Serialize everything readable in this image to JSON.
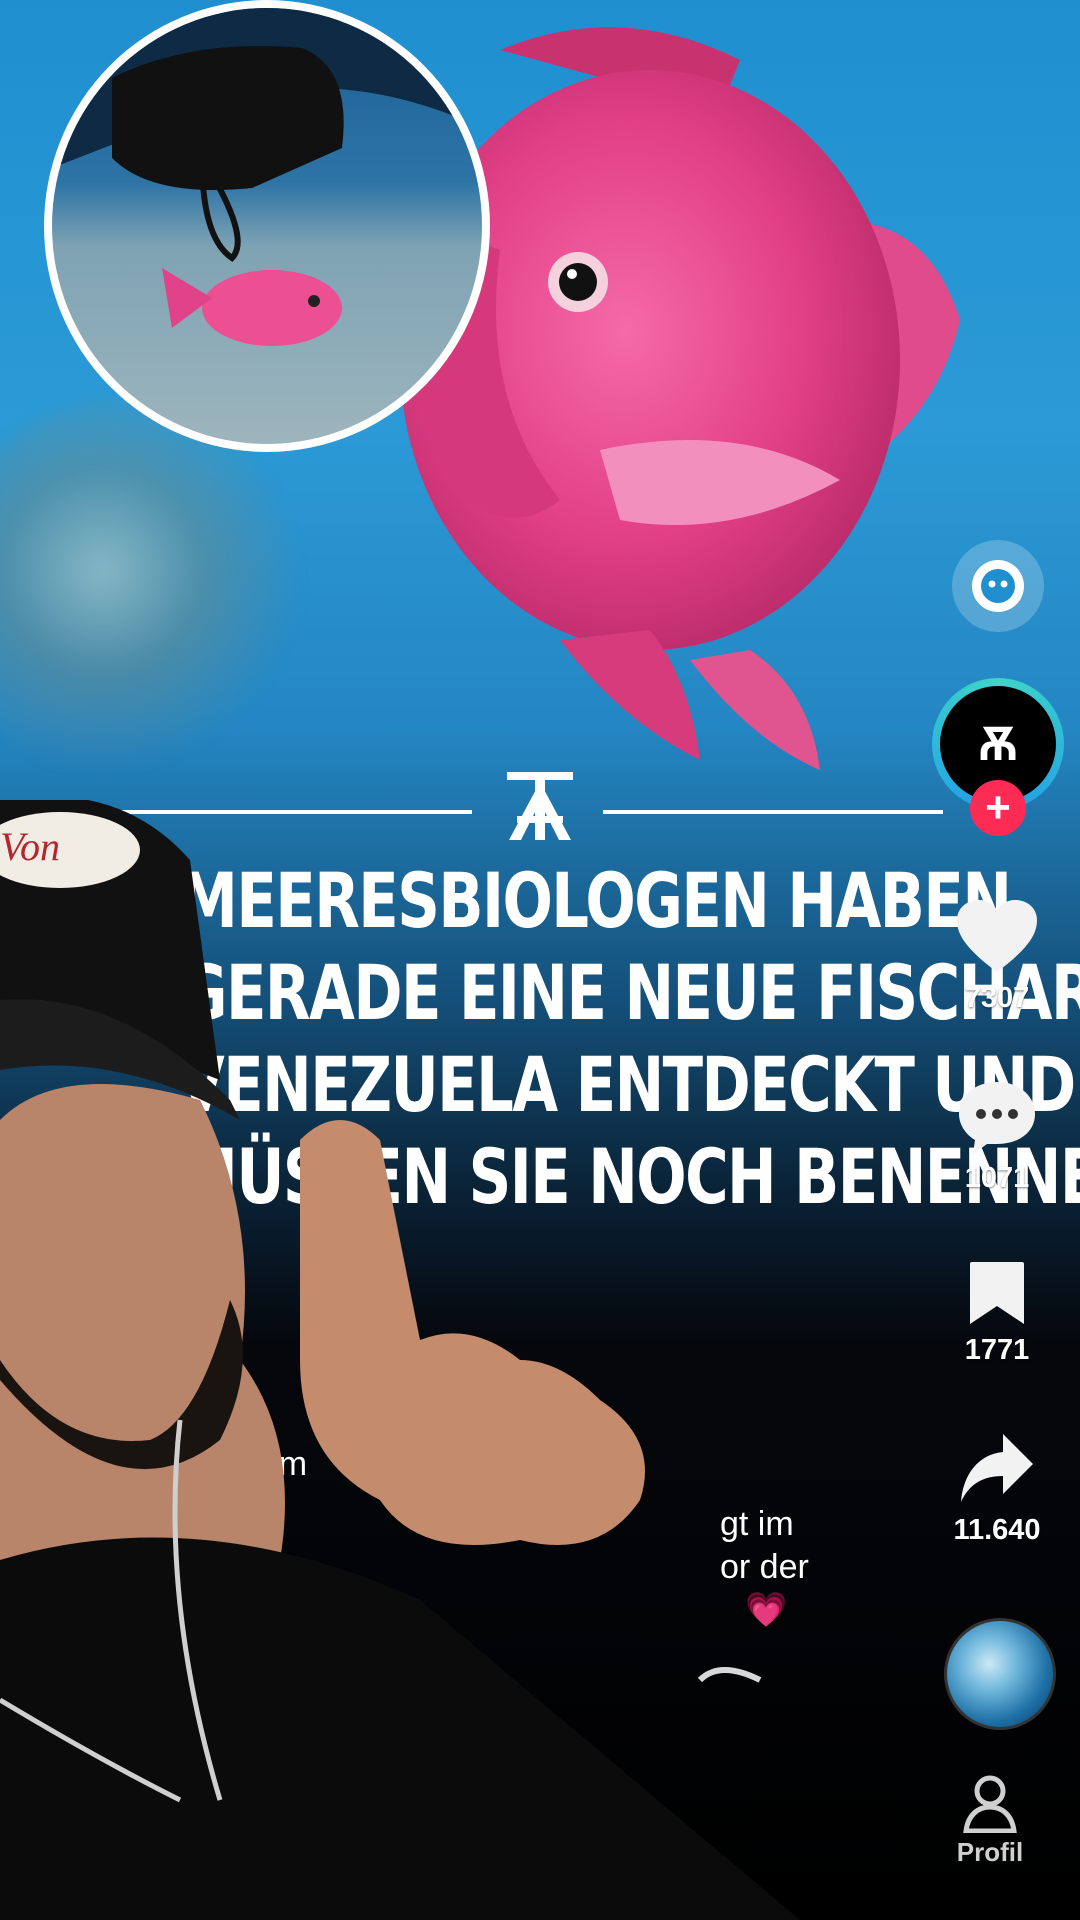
{
  "headline": {
    "lines": [
      "MEERESBIOLOGEN HABEN",
      "GERADE EINE NEUE FISCHART IN",
      "VENEZUELA ENTDECKT UND",
      "MÜSSEN SIE NOCH BENENNEN"
    ]
  },
  "rail": {
    "like_count": "7307",
    "comment_count": "1071",
    "save_count": "1771",
    "share_count": "11.640"
  },
  "avatar": {
    "initial": "Ѫ",
    "follow_symbol": "+"
  },
  "caption": {
    "username_fragment": "ancem",
    "text_line1": "gt im",
    "text_line2": "or der",
    "emoji": "💗"
  },
  "bottom_nav": {
    "profile_label": "Profil"
  },
  "cap_text": "Von",
  "colors": {
    "follow": "#fe2c55",
    "ring": "#1f9be8",
    "fish": "#e8408a"
  }
}
